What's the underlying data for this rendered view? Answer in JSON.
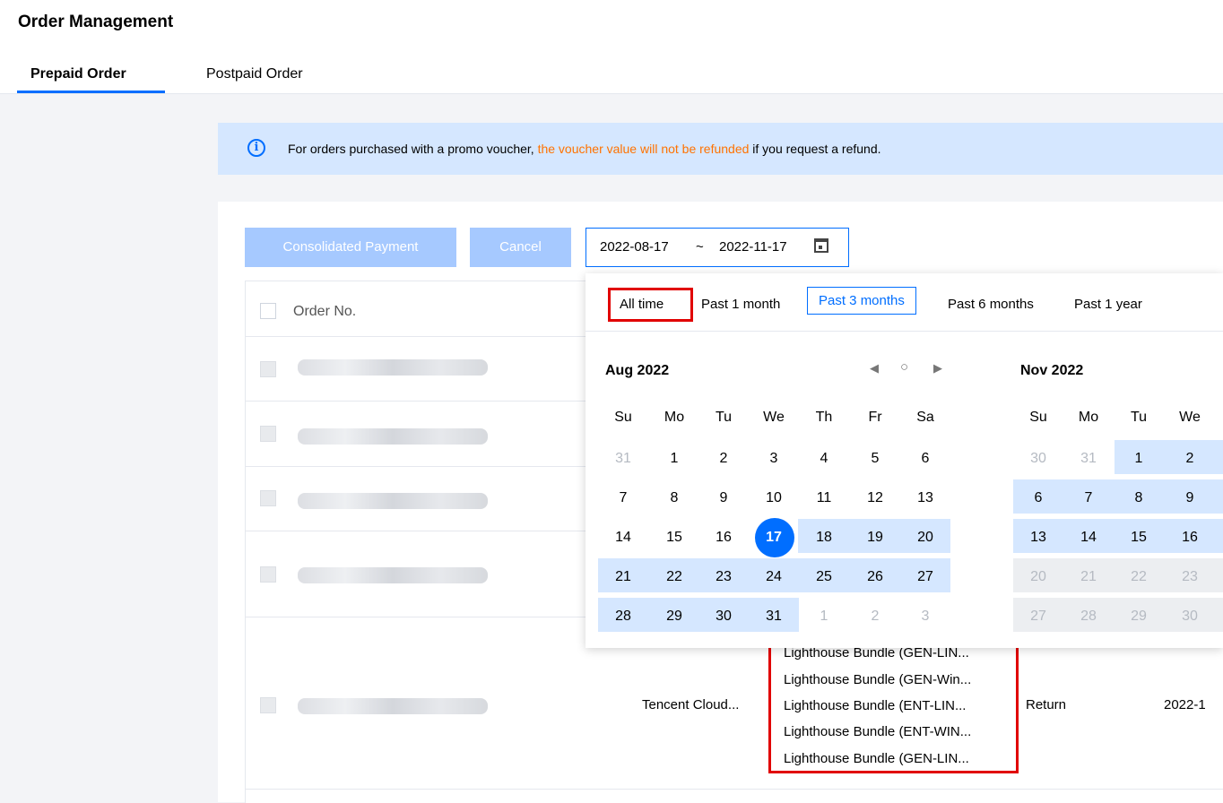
{
  "header": {
    "title": "Order Management",
    "tabs": [
      {
        "label": "Prepaid Order",
        "active": true
      },
      {
        "label": "Postpaid Order",
        "active": false
      }
    ]
  },
  "notice": {
    "icon": "info-icon",
    "text_before": "For orders purchased with a promo voucher, ",
    "text_warn": "the voucher value will not be refunded",
    "text_after": " if you request a refund.",
    "warn_color": "#ff7200"
  },
  "toolbar": {
    "consolidated_payment_label": "Consolidated Payment",
    "cancel_label": "Cancel",
    "date_from": "2022-08-17",
    "date_sep": "~",
    "date_to": "2022-11-17",
    "calendar_icon": "calendar-icon"
  },
  "table": {
    "header_order_no": "Order No.",
    "row5": {
      "product": "Tencent Cloud...",
      "type": "Return",
      "date": "2022-1"
    }
  },
  "datepicker": {
    "quick_ranges": [
      "All time",
      "Past 1 month",
      "Past 3 months",
      "Past 6 months",
      "Past 1 year"
    ],
    "selected_quick_range": "Past 3 months",
    "left_month": "Aug 2022",
    "right_month": "Nov 2022",
    "weekdays": [
      "Su",
      "Mo",
      "Tu",
      "We",
      "Th",
      "Fr",
      "Sa"
    ],
    "right_weekdays": [
      "Su",
      "Mo",
      "Tu",
      "We"
    ],
    "aug_weeks": [
      [
        "31",
        "1",
        "2",
        "3",
        "4",
        "5",
        "6"
      ],
      [
        "7",
        "8",
        "9",
        "10",
        "11",
        "12",
        "13"
      ],
      [
        "14",
        "15",
        "16",
        "17",
        "18",
        "19",
        "20"
      ],
      [
        "21",
        "22",
        "23",
        "24",
        "25",
        "26",
        "27"
      ],
      [
        "28",
        "29",
        "30",
        "31",
        "1",
        "2",
        "3"
      ]
    ],
    "nov_weeks": [
      [
        "30",
        "31",
        "1",
        "2"
      ],
      [
        "6",
        "7",
        "8",
        "9"
      ],
      [
        "13",
        "14",
        "15",
        "16"
      ],
      [
        "20",
        "21",
        "22",
        "23"
      ],
      [
        "27",
        "28",
        "29",
        "30"
      ]
    ],
    "selected_day": "17",
    "accent_color": "#006eff",
    "range_color": "#d5e7ff"
  },
  "products": [
    "Lighthouse Bundle (GEN-LIN...",
    "Lighthouse Bundle (GEN-Win...",
    "Lighthouse Bundle (ENT-LIN...",
    "Lighthouse Bundle (ENT-WIN...",
    "Lighthouse Bundle (GEN-LIN..."
  ]
}
